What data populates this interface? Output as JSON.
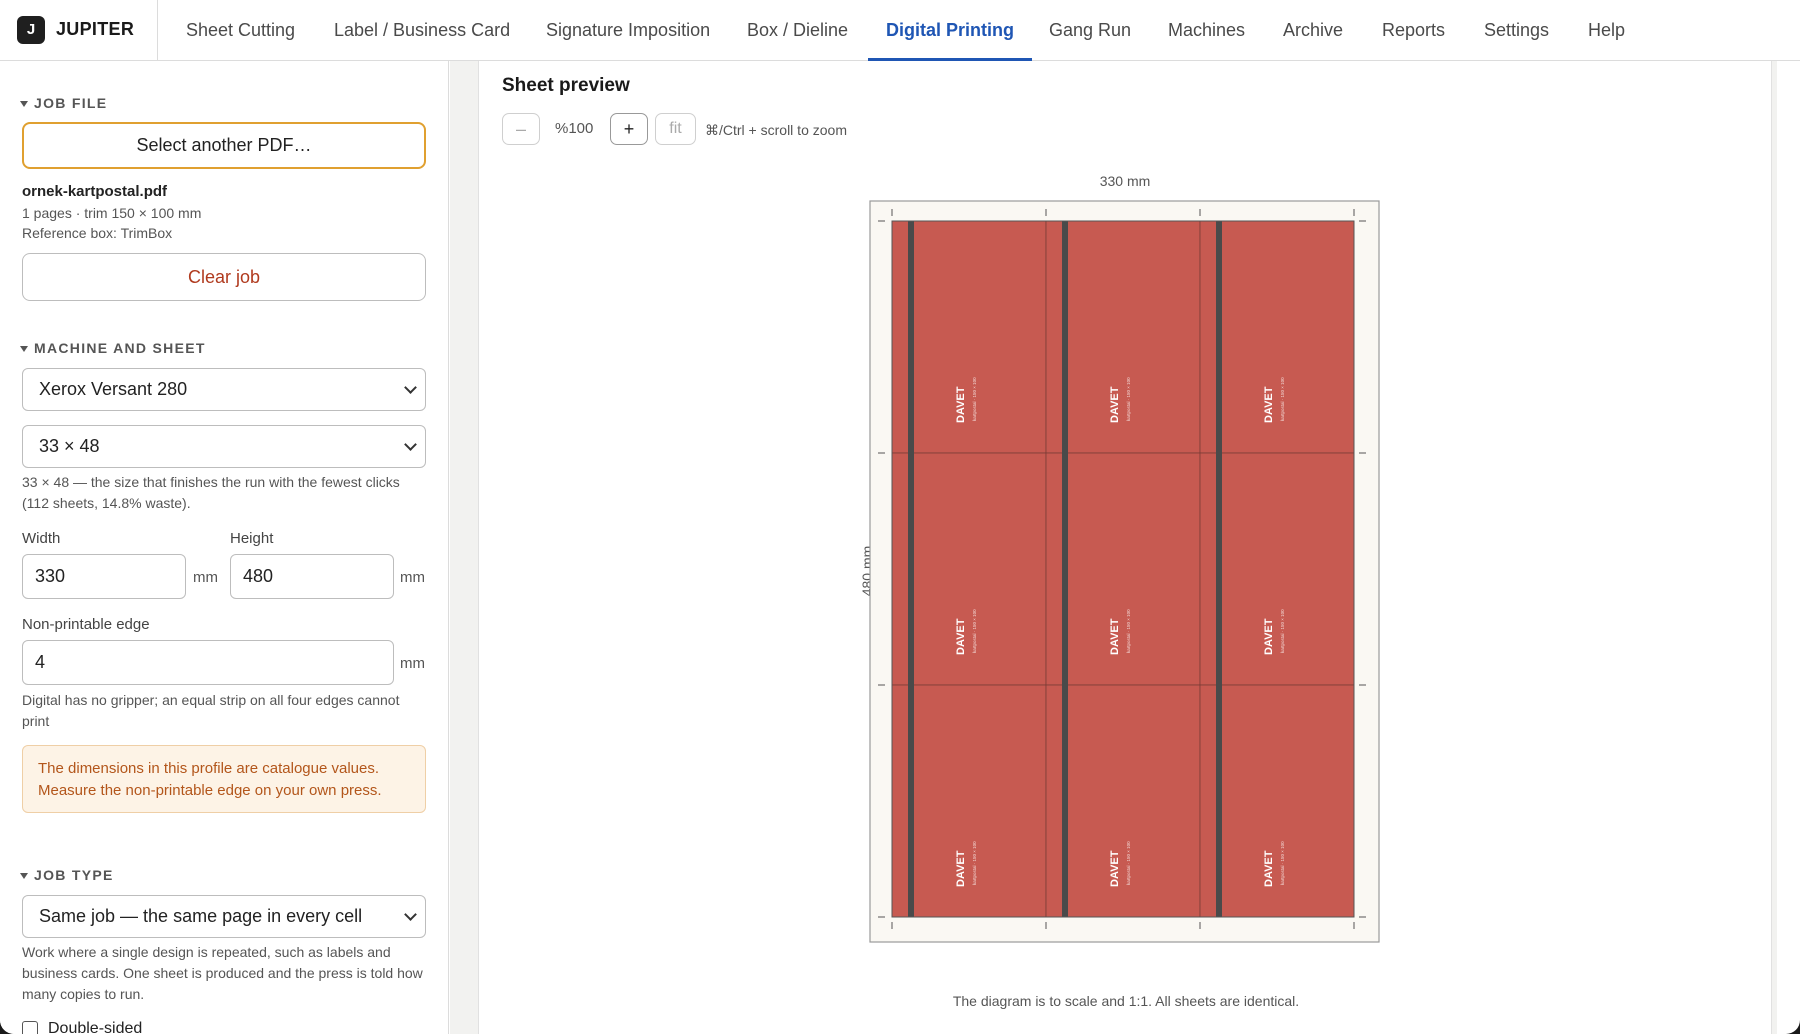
{
  "brand": {
    "logo_letter": "J",
    "name": "JUPITER"
  },
  "nav": {
    "tabs": [
      {
        "label": "Sheet Cutting",
        "active": false
      },
      {
        "label": "Label / Business Card",
        "active": false
      },
      {
        "label": "Signature Imposition",
        "active": false
      },
      {
        "label": "Box / Dieline",
        "active": false
      },
      {
        "label": "Digital Printing",
        "active": true
      },
      {
        "label": "Gang Run",
        "active": false
      },
      {
        "label": "Machines",
        "active": false
      },
      {
        "label": "Archive",
        "active": false
      },
      {
        "label": "Reports",
        "active": false
      },
      {
        "label": "Settings",
        "active": false
      },
      {
        "label": "Help",
        "active": false
      }
    ]
  },
  "sidebar": {
    "job_file": {
      "heading": "JOB FILE",
      "select_button": "Select another PDF…",
      "file_name": "ornek-kartpostal.pdf",
      "file_info": "1 pages · trim 150 × 100 mm",
      "reference_box": "Reference box: TrimBox",
      "clear_button": "Clear job"
    },
    "machine": {
      "heading": "MACHINE AND SHEET",
      "machine_value": "Xerox Versant 280",
      "sheet_value": "33 × 48",
      "sheet_note": "33 × 48 — the size that finishes the run with the fewest clicks (112 sheets, 14.8% waste).",
      "width_label": "Width",
      "width_value": "330",
      "height_label": "Height",
      "height_value": "480",
      "unit": "mm",
      "edge_label": "Non-printable edge",
      "edge_value": "4",
      "edge_note": "Digital has no gripper; an equal strip on all four edges cannot print",
      "warning": "The dimensions in this profile are catalogue values. Measure the non-printable edge on your own press."
    },
    "job_type": {
      "heading": "JOB TYPE",
      "value": "Same job — the same page in every cell",
      "note": "Work where a single design is repeated, such as labels and business cards. One sheet is produced and the press is told how many copies to run.",
      "double_sided_label": "Double-sided"
    }
  },
  "preview": {
    "title": "Sheet preview",
    "zoom_out": "–",
    "zoom_level": "%100",
    "zoom_in": "+",
    "fit": "fit",
    "zoom_hint": "⌘/Ctrl + scroll to zoom",
    "width_label": "330 mm",
    "height_label": "480 mm",
    "caption": "The diagram is to scale and 1:1. All sheets are identical.",
    "cell_title": "DAVET",
    "cell_subtitle": "kartpostal · 150 × 100",
    "grid": {
      "columns": 3,
      "rows": 3
    },
    "colors": {
      "cell_fill": "#c75a51",
      "cell_bar": "#4a4a4a",
      "sheet_fill": "#faf8f3"
    }
  }
}
